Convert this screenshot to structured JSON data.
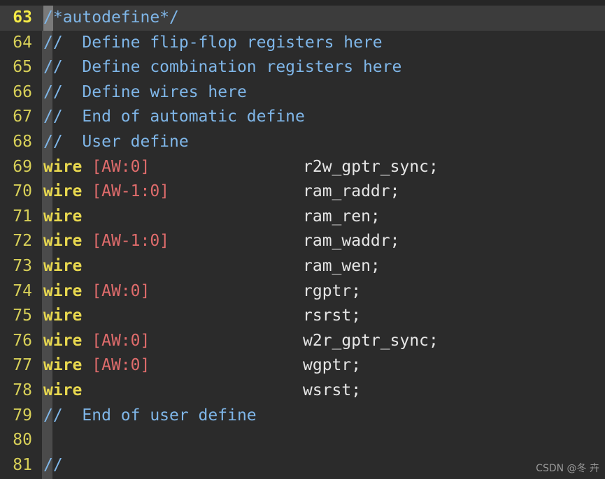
{
  "editor": {
    "current_line": "63",
    "lines": [
      {
        "num": "63",
        "kind": "comment",
        "lead": "/",
        "text": "*autodefine*/"
      },
      {
        "num": "64",
        "kind": "comment",
        "text": "//  Define flip-flop registers here"
      },
      {
        "num": "65",
        "kind": "comment",
        "text": "//  Define combination registers here"
      },
      {
        "num": "66",
        "kind": "comment",
        "text": "//  Define wires here"
      },
      {
        "num": "67",
        "kind": "comment",
        "text": "//  End of automatic define"
      },
      {
        "num": "68",
        "kind": "comment",
        "text": "//  User define"
      },
      {
        "num": "69",
        "kind": "decl",
        "kw": "wire",
        "range": "[AW:0]",
        "ident": "r2w_gptr_sync;"
      },
      {
        "num": "70",
        "kind": "decl",
        "kw": "wire",
        "range": "[AW-1:0]",
        "ident": "ram_raddr;"
      },
      {
        "num": "71",
        "kind": "decl",
        "kw": "wire",
        "range": "",
        "ident": "ram_ren;"
      },
      {
        "num": "72",
        "kind": "decl",
        "kw": "wire",
        "range": "[AW-1:0]",
        "ident": "ram_waddr;"
      },
      {
        "num": "73",
        "kind": "decl",
        "kw": "wire",
        "range": "",
        "ident": "ram_wen;"
      },
      {
        "num": "74",
        "kind": "decl",
        "kw": "wire",
        "range": "[AW:0]",
        "ident": "rgptr;"
      },
      {
        "num": "75",
        "kind": "decl",
        "kw": "wire",
        "range": "",
        "ident": "rsrst;"
      },
      {
        "num": "76",
        "kind": "decl",
        "kw": "wire",
        "range": "[AW:0]",
        "ident": "w2r_gptr_sync;"
      },
      {
        "num": "77",
        "kind": "decl",
        "kw": "wire",
        "range": "[AW:0]",
        "ident": "wgptr;"
      },
      {
        "num": "78",
        "kind": "decl",
        "kw": "wire",
        "range": "",
        "ident": "wsrst;"
      },
      {
        "num": "79",
        "kind": "comment",
        "text": "//  End of user define"
      },
      {
        "num": "80",
        "kind": "empty",
        "text": ""
      },
      {
        "num": "81",
        "kind": "comment",
        "text": "//"
      }
    ]
  },
  "watermark": "CSDN @冬 卉",
  "colors": {
    "background": "#2b2b2b",
    "line_number": "#d8d058",
    "comment": "#7fb6e8",
    "keyword": "#e8d84f",
    "range": "#e06c6c",
    "identifier": "#e6e6e6"
  }
}
